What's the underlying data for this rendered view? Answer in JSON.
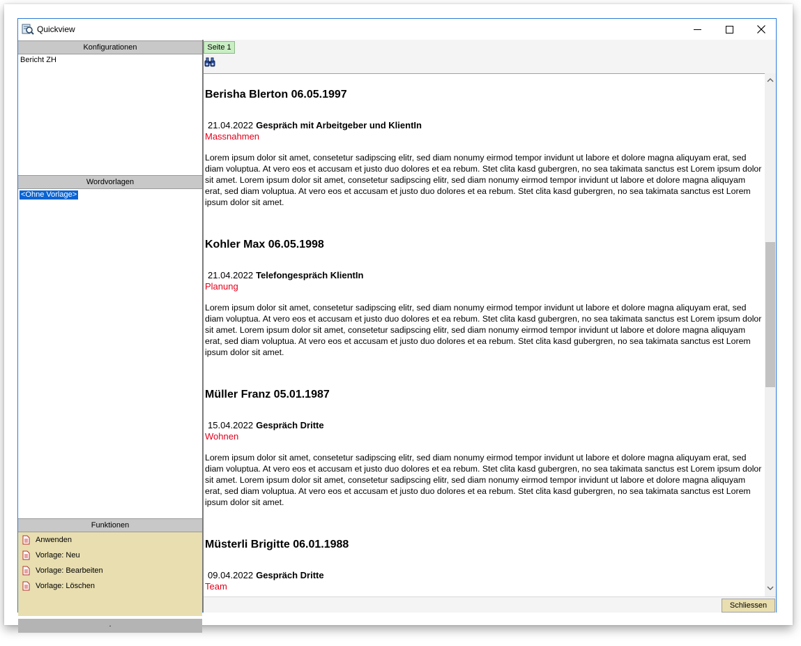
{
  "window": {
    "title": "Quickview"
  },
  "left": {
    "konfigurationen": {
      "header": "Konfigurationen",
      "items": [
        "Bericht ZH"
      ]
    },
    "wordvorlagen": {
      "header": "Wordvorlagen",
      "items": [
        "<Ohne Vorlage>"
      ]
    },
    "funktionen": {
      "header": "Funktionen",
      "items": [
        "Anwenden",
        "Vorlage: Neu",
        "Vorlage: Bearbeiten",
        "Vorlage: Löschen"
      ]
    },
    "footer": "."
  },
  "tabs": [
    "Seite 1"
  ],
  "entries": [
    {
      "heading": "Berisha Blerton 06.05.1997",
      "date": "21.04.2022",
      "subject": "Gespräch mit Arbeitgeber und KlientIn",
      "category": "Massnahmen",
      "text": "Lorem ipsum dolor sit amet, consetetur sadipscing elitr, sed diam nonumy eirmod tempor invidunt ut labore et dolore magna aliquyam erat, sed diam voluptua. At vero eos et accusam et justo duo dolores et ea rebum. Stet clita kasd gubergren, no sea takimata sanctus est Lorem ipsum dolor sit amet. Lorem ipsum dolor sit amet, consetetur sadipscing elitr, sed diam nonumy eirmod tempor invidunt ut labore et dolore magna aliquyam erat, sed diam voluptua. At vero eos et accusam et justo duo dolores et ea rebum. Stet clita kasd gubergren, no sea takimata sanctus est Lorem ipsum dolor sit amet."
    },
    {
      "heading": "Kohler Max 06.05.1998",
      "date": "21.04.2022",
      "subject": "Telefongespräch KlientIn",
      "category": "Planung",
      "text": "Lorem ipsum dolor sit amet, consetetur sadipscing elitr, sed diam nonumy eirmod tempor invidunt ut labore et dolore magna aliquyam erat, sed diam voluptua. At vero eos et accusam et justo duo dolores et ea rebum. Stet clita kasd gubergren, no sea takimata sanctus est Lorem ipsum dolor sit amet. Lorem ipsum dolor sit amet, consetetur sadipscing elitr, sed diam nonumy eirmod tempor invidunt ut labore et dolore magna aliquyam erat, sed diam voluptua. At vero eos et accusam et justo duo dolores et ea rebum. Stet clita kasd gubergren, no sea takimata sanctus est Lorem ipsum dolor sit amet."
    },
    {
      "heading": "Müller Franz 05.01.1987",
      "date": "15.04.2022",
      "subject": "Gespräch Dritte",
      "category": "Wohnen",
      "text": "Lorem ipsum dolor sit amet, consetetur sadipscing elitr, sed diam nonumy eirmod tempor invidunt ut labore et dolore magna aliquyam erat, sed diam voluptua. At vero eos et accusam et justo duo dolores et ea rebum. Stet clita kasd gubergren, no sea takimata sanctus est Lorem ipsum dolor sit amet. Lorem ipsum dolor sit amet, consetetur sadipscing elitr, sed diam nonumy eirmod tempor invidunt ut labore et dolore magna aliquyam erat, sed diam voluptua. At vero eos et accusam et justo duo dolores et ea rebum. Stet clita kasd gubergren, no sea takimata sanctus est Lorem ipsum dolor sit amet."
    },
    {
      "heading": "Müsterli Brigitte 06.01.1988",
      "date": "09.04.2022",
      "subject": "Gespräch Dritte",
      "category": "Team",
      "text": ""
    }
  ],
  "buttons": {
    "close": "Schliessen"
  },
  "colors": {
    "category": "#e0001b",
    "selection": "#0a64d2",
    "functions_bg": "#e8deb0",
    "tab_bg": "#c9eec4"
  }
}
